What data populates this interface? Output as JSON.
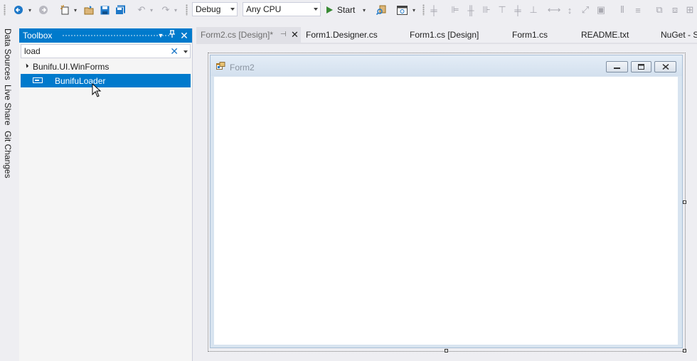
{
  "toolbar": {
    "config_value": "Debug",
    "platform_value": "Any CPU",
    "start_label": "Start"
  },
  "side_tabs": [
    "Data Sources",
    "Live Share",
    "Git Changes"
  ],
  "toolbox": {
    "title": "Toolbox",
    "search_value": "load",
    "group_label": "Bunifu.UI.WinForms",
    "item_label": "BunifuLoader"
  },
  "tabs": {
    "active": "Form2.cs [Design]*",
    "others": [
      "Form1.Designer.cs",
      "Form1.cs [Design]",
      "Form1.cs",
      "README.txt",
      "NuGet - S"
    ]
  },
  "form": {
    "title": "Form2"
  },
  "colors": {
    "accent": "#007acc",
    "chrome": "#eeeef2",
    "form_client": "#ffffff"
  }
}
